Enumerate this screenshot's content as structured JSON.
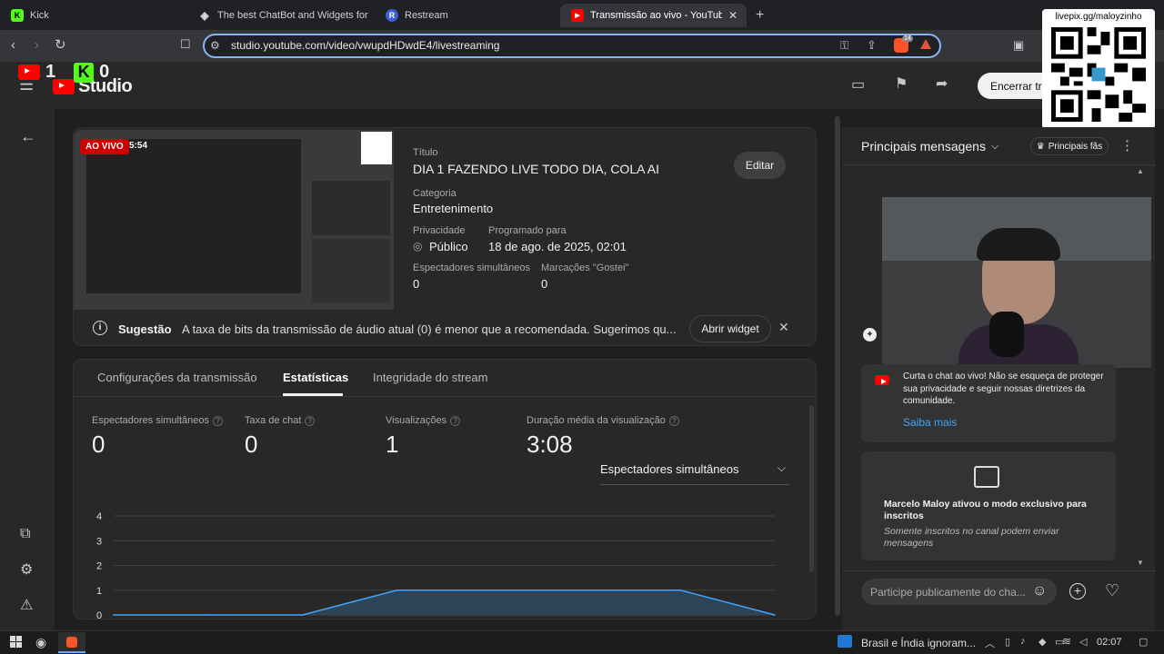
{
  "browser": {
    "tabs": [
      {
        "label": "Kick",
        "favicon": "kick-logo"
      },
      {
        "label": "The best ChatBot and Widgets for Kick",
        "favicon": "botrix-logo"
      },
      {
        "label": "Restream",
        "favicon": "restream-logo"
      },
      {
        "label": "Transmissão ao vivo - YouTube Studio",
        "favicon": "youtube-logo"
      }
    ],
    "url": "studio.youtube.com/video/vwupdHDwdE4/livestreaming",
    "brave_badge": "14"
  },
  "overlay": {
    "youtube_viewers": "1",
    "kick_viewers": "0",
    "qr_caption": "livepix.gg/maloyzinho"
  },
  "studio": {
    "logo_text": "Studio",
    "end_button": "Encerrar tra"
  },
  "stream": {
    "live_badge": "AO VIVO",
    "duration": "5:54",
    "title_label": "Título",
    "title": "DIA 1 FAZENDO LIVE TODO DIA, COLA AI",
    "edit_button": "Editar",
    "category_label": "Categoria",
    "category": "Entretenimento",
    "privacy_label": "Privacidade",
    "privacy": "Público",
    "scheduled_label": "Programado para",
    "scheduled": "18 de ago. de 2025, 02:01",
    "viewers_label": "Espectadores simultâneos",
    "viewers": "0",
    "likes_label": "Marcações \"Gostei\"",
    "likes": "0",
    "suggestion_label": "Sugestão",
    "suggestion_text": "A taxa de bits da transmissão de áudio atual (0) é menor que a recomendada. Sugerimos qu...",
    "open_widget": "Abrir widget"
  },
  "stats": {
    "tabs": [
      "Configurações da transmissão",
      "Estatísticas",
      "Integridade do stream"
    ],
    "metrics": [
      {
        "label": "Espectadores simultâneos",
        "value": "0"
      },
      {
        "label": "Taxa de chat",
        "value": "0"
      },
      {
        "label": "Visualizações",
        "value": "1"
      },
      {
        "label": "Duração média da visualização",
        "value": "3:08"
      }
    ],
    "dropdown": "Espectadores simultâneos"
  },
  "chart_data": {
    "type": "area",
    "yticks": [
      "4",
      "3",
      "2",
      "1",
      "0"
    ],
    "ylim": [
      0,
      4
    ],
    "x": [
      0,
      1,
      2,
      3,
      4,
      5,
      6,
      7
    ],
    "values": [
      0,
      0,
      0,
      1,
      1,
      1,
      1,
      0
    ],
    "color": "#3ea6ff",
    "fill": "#2f4658"
  },
  "chat": {
    "header": "Principais mensagens",
    "top_fans": "Principais fãs",
    "welcome": "Curta o chat ao vivo! Não se esqueça de proteger sua privacidade e seguir nossas diretrizes da comunidade.",
    "learn_more": "Saiba mais",
    "members_title": "Marcelo Maloy ativou o modo exclusivo para inscritos",
    "members_sub": "Somente inscritos no canal podem enviar mensagens",
    "input_placeholder": "Participe publicamente do cha..."
  },
  "taskbar": {
    "news": "Brasil e Índia ignoram...",
    "time": "02:07"
  }
}
